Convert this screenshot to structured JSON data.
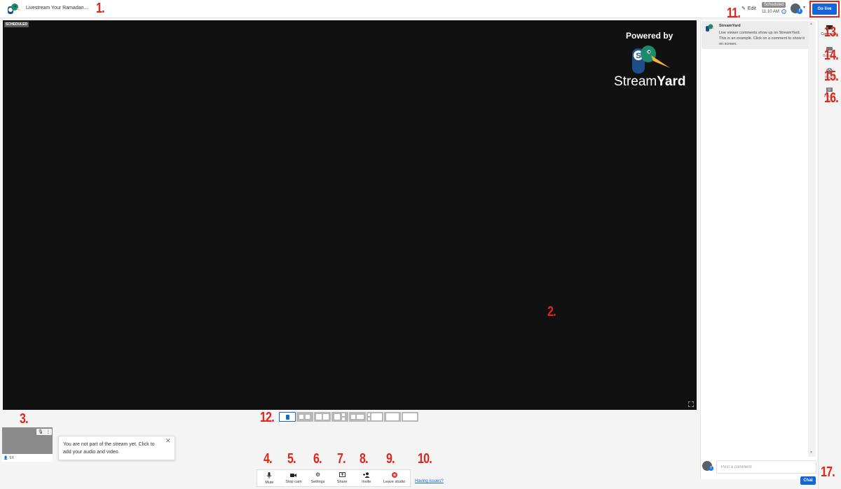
{
  "header": {
    "title": "Livestream Your Ramadan...",
    "edit_label": "Edit",
    "status_badge": "Scheduled",
    "scheduled_time": "11:10 AM",
    "go_live_label": "Go live"
  },
  "stage": {
    "badge": "SCHEDULED",
    "powered_by": "Powered by",
    "brand_light": "Stream",
    "brand_bold": "Yard"
  },
  "self_tile": {
    "name": "SY",
    "tooltip": "You are not part of the stream yet. Click to add your audio and video."
  },
  "controls": {
    "mute": "Mute",
    "stop_cam": "Stop cam",
    "settings": "Settings",
    "share": "Share",
    "invite": "Invite",
    "leave": "Leave studio",
    "issues": "Having issues?"
  },
  "comments": {
    "author": "StreamYard",
    "text": "Live viewer comments show up on StreamYard. This is an example. Click on a comment to show it on screen.",
    "input_placeholder": "Post a comment",
    "chat_button": "Chat"
  },
  "rail": {
    "comments": "Comments",
    "banners": "Banners",
    "brand": "Brand",
    "private_chat": "Private chat"
  },
  "annotations": {
    "n1": "1.",
    "n2": "2.",
    "n3": "3.",
    "n4": "4.",
    "n5": "5.",
    "n6": "6.",
    "n7": "7.",
    "n8": "8.",
    "n9": "9.",
    "n10": "10.",
    "n11": "11.",
    "n12": "12.",
    "n13": "13.",
    "n14": "14.",
    "n15": "15.",
    "n16": "16.",
    "n17": "17."
  },
  "colors": {
    "accent": "#1565d8",
    "annotation_red": "#e1251b",
    "stage_bg": "#111111"
  }
}
